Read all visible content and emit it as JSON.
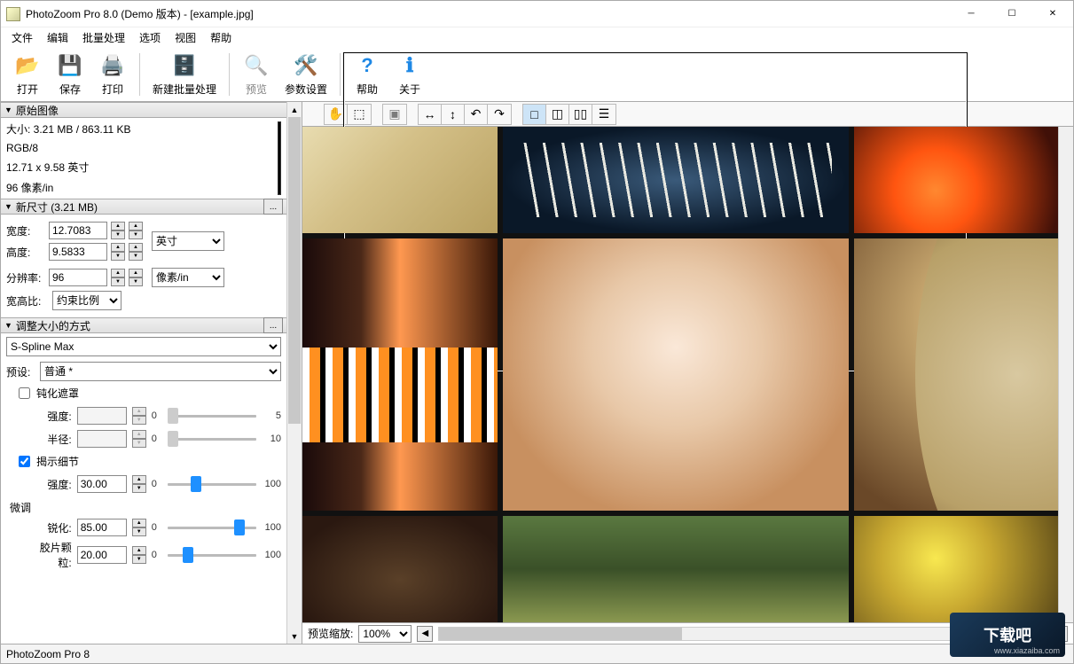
{
  "titlebar": {
    "title": "PhotoZoom Pro 8.0 (Demo 版本) - [example.jpg]"
  },
  "menubar": {
    "items": [
      "文件",
      "编辑",
      "批量处理",
      "选项",
      "视图",
      "帮助"
    ]
  },
  "toolbar": {
    "open": "打开",
    "save": "保存",
    "print": "打印",
    "batch": "新建批量处理",
    "preview": "预览",
    "params": "参数设置",
    "help": "帮助",
    "about": "关于"
  },
  "sec_original": {
    "title": "原始图像",
    "size": "大小: 3.21 MB / 863.11 KB",
    "colormode": "RGB/8",
    "dims": "12.71 x 9.58 英寸",
    "dpi": "96 像素/in"
  },
  "sec_newsize": {
    "title": "新尺寸 (3.21 MB)",
    "width_lbl": "宽度:",
    "width_val": "12.7083",
    "height_lbl": "高度:",
    "height_val": "9.5833",
    "unit_opt": "英寸",
    "res_lbl": "分辨率:",
    "res_val": "96",
    "res_unit": "像素/in",
    "aspect_lbl": "宽高比:",
    "aspect_opt": "约束比例"
  },
  "sec_resize": {
    "title": "调整大小的方式",
    "method": "S-Spline Max",
    "preset_lbl": "预设:",
    "preset_val": "普通 *",
    "unsharp_chk": "钝化遮罩",
    "intensity_lbl": "强度:",
    "intensity_val": "",
    "radius_lbl": "半径:",
    "radius_val": "",
    "reveal_chk": "揭示细节",
    "reveal_intensity_lbl": "强度:",
    "reveal_intensity_val": "30.00",
    "fine_lbl": "微调",
    "sharp_lbl": "锐化:",
    "sharp_val": "85.00",
    "grain_lbl": "胶片颗粒:",
    "grain_val": "20.00",
    "val0": "0",
    "val5": "5",
    "val10": "10",
    "val100": "100"
  },
  "zoom": {
    "label": "预览缩放:",
    "value": "100%"
  },
  "status": {
    "text": "PhotoZoom Pro 8"
  },
  "watermark": {
    "text": "下载吧",
    "sub": "www.xiazaiba.com"
  }
}
